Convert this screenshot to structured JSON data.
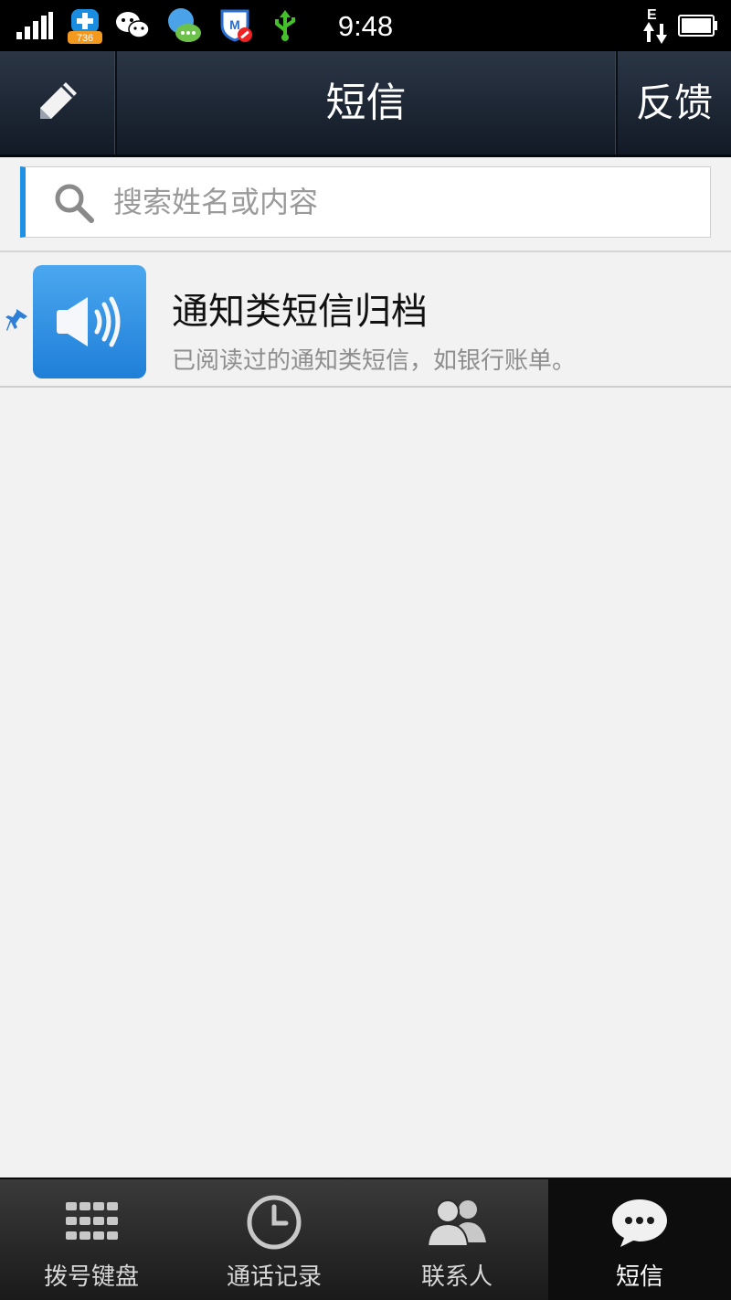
{
  "status_bar": {
    "time": "9:48",
    "badge_count": "736",
    "network_type": "E",
    "icons": [
      "signal-icon",
      "health-app-icon",
      "wechat-icon",
      "chat-app-icon",
      "security-shield-icon",
      "usb-icon",
      "network-icon",
      "battery-icon"
    ]
  },
  "header": {
    "title": "短信",
    "feedback_label": "反馈",
    "compose_icon": "pencil-icon"
  },
  "search": {
    "placeholder": "搜索姓名或内容"
  },
  "list": {
    "items": [
      {
        "title": "通知类短信归档",
        "subtitle": "已阅读过的通知类短信，如银行账单。",
        "icon": "speaker-icon",
        "pinned": true
      }
    ]
  },
  "tabbar": {
    "tabs": [
      {
        "label": "拨号键盘",
        "icon": "keypad-icon"
      },
      {
        "label": "通话记录",
        "icon": "clock-icon"
      },
      {
        "label": "联系人",
        "icon": "contacts-icon"
      },
      {
        "label": "短信",
        "icon": "message-icon",
        "active": true
      }
    ]
  },
  "colors": {
    "accent": "#1e90e6",
    "header_bg": "#1a2330",
    "list_bg": "#f2f2f2",
    "tabbar_bg": "#2a2a2a"
  }
}
